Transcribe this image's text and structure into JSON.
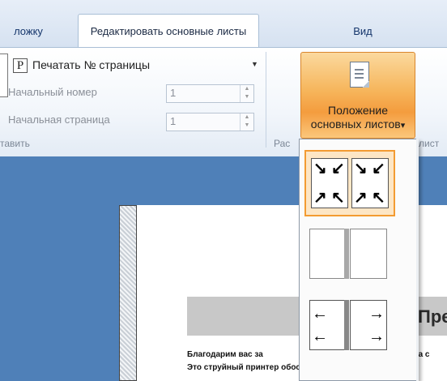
{
  "tabs": {
    "cover": "ложку",
    "edit": "Редактировать основные листы",
    "view": "Вид"
  },
  "ribbon": {
    "print_checkbox_glyph": "P",
    "print_page_number": "Печатать № страницы",
    "start_number_label": "Начальный номер",
    "start_number_value": "1",
    "start_page_label": "Начальная страница",
    "start_page_value": "1",
    "group1": "тавить",
    "group2": "Рас",
    "group3": "лист",
    "position_button_line1": "Положение",
    "position_button_line2": "основных листов",
    "dropdown_arrow": "▾"
  },
  "dropdown": {
    "options": [
      {
        "name": "corner-arrows-layout",
        "selected": true
      },
      {
        "name": "plain-spread-layout",
        "selected": false
      },
      {
        "name": "side-arrows-layout",
        "selected": false
      }
    ]
  },
  "document": {
    "title": "Пре",
    "line1": "Благодарим вас за",
    "line1_right": "тера с",
    "line2": "Это струйный принтер обособ. Ов для вы"
  },
  "colors": {
    "accent": "#f49c3e",
    "workspace": "#4f80b8",
    "tab_text": "#15356b"
  }
}
